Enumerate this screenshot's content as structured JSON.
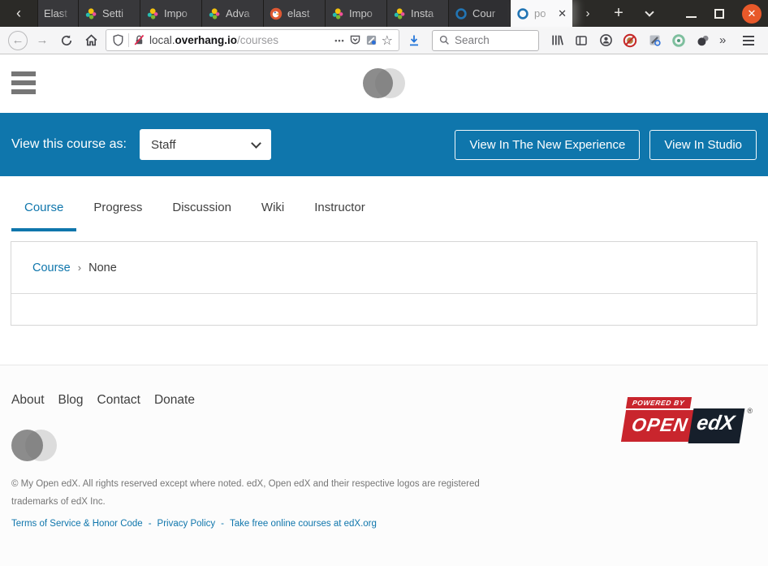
{
  "browser": {
    "tab_scroll_left_glyph": "‹",
    "tab_scroll_right_glyph": "›",
    "new_tab_glyph": "+",
    "tabs": [
      {
        "title": "Elast"
      },
      {
        "title": "Setti"
      },
      {
        "title": "Impo"
      },
      {
        "title": "Adva"
      },
      {
        "title": "elast"
      },
      {
        "title": "Impo"
      },
      {
        "title": "Insta"
      },
      {
        "title": "Cour"
      },
      {
        "title": "po",
        "close_glyph": "✕"
      }
    ],
    "window_controls": {
      "close_glyph": "✕"
    },
    "toolbar": {
      "back_glyph": "←",
      "forward_glyph": "→",
      "url_subdomain": "local.",
      "url_domain": "overhang.io",
      "url_path": "/courses",
      "page_actions_glyph": "•••",
      "star_glyph": "☆",
      "search_placeholder": "Search",
      "overflow_glyph": "»"
    }
  },
  "banner": {
    "label": "View this course as:",
    "dropdown_value": "Staff",
    "new_experience_button": "View In The New Experience",
    "studio_button": "View In Studio"
  },
  "course_nav": {
    "tabs": [
      {
        "label": "Course",
        "active": true
      },
      {
        "label": "Progress",
        "active": false
      },
      {
        "label": "Discussion",
        "active": false
      },
      {
        "label": "Wiki",
        "active": false
      },
      {
        "label": "Instructor",
        "active": false
      }
    ]
  },
  "breadcrumb": {
    "course_link": "Course",
    "separator": "›",
    "current": "None"
  },
  "footer": {
    "links": [
      {
        "label": "About"
      },
      {
        "label": "Blog"
      },
      {
        "label": "Contact"
      },
      {
        "label": "Donate"
      }
    ],
    "powered_by": {
      "tag": "POWERED BY",
      "open": "OPEN",
      "edx": "edX",
      "registered": "®"
    },
    "copyright": "© My Open edX. All rights reserved except where noted. edX, Open edX and their respective logos are registered trademarks of edX Inc.",
    "legal": {
      "terms": "Terms of Service & Honor Code",
      "separator": "-",
      "privacy": "Privacy Policy",
      "courses": "Take free online courses at edX.org"
    }
  },
  "colors": {
    "accent_blue": "#0f76ac",
    "powered_by_red": "#c9252d",
    "powered_by_navy": "#161f2b",
    "window_close_orange": "#e8592a",
    "download_blue": "#2576d9"
  }
}
